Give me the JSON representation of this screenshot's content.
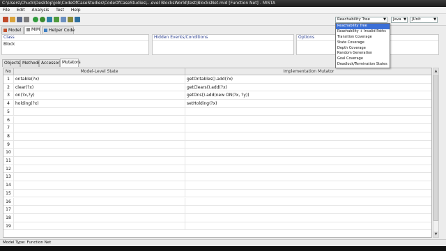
{
  "window": {
    "title": "C:\\Users\\Chuck\\Desktop\\job\\CodeOfCaseStudies\\CodeOfCaseStudies\\...evel BlocksWorld\\test\\BlocksNet.mid [Function Net] - MISTA"
  },
  "menu": [
    "File",
    "Edit",
    "Analysis",
    "Test",
    "Help"
  ],
  "toolbar": {
    "coverage_selected": "Reachability Tree",
    "language": "Java",
    "framework": "JUnit"
  },
  "coverage_options": [
    "Reachability Tree",
    "Reachability + Invalid Paths",
    "Transition Coverage",
    "State Coverage",
    "Depth Coverage",
    "Random Generation",
    "Goal Coverage",
    "Deadlock/Termination States"
  ],
  "top_tabs": [
    "Model",
    "MIM",
    "Helper Code"
  ],
  "panels": {
    "class_header": "Class",
    "class_value": "Block",
    "hidden_header": "Hidden Events/Conditions",
    "options_header": "Options"
  },
  "sub_tabs": [
    "Objects",
    "Methods",
    "Accessors",
    "Mutators"
  ],
  "grid": {
    "headers": [
      "No",
      "Model-Level State",
      "Implementation Mutator"
    ],
    "rows": [
      [
        "1",
        "ontable(?x)",
        "getOntables().add(?x)"
      ],
      [
        "2",
        "clear(?x)",
        "getClears().add(?x)"
      ],
      [
        "3",
        "on(?x,?y)",
        "getOns().add(new ON(?x, ?y))"
      ],
      [
        "4",
        "holding(?x)",
        "setHolding(?x)"
      ],
      [
        "5",
        "",
        ""
      ],
      [
        "6",
        "",
        ""
      ],
      [
        "7",
        "",
        ""
      ],
      [
        "8",
        "",
        ""
      ],
      [
        "9",
        "",
        ""
      ],
      [
        "10",
        "",
        ""
      ],
      [
        "11",
        "",
        ""
      ],
      [
        "12",
        "",
        ""
      ],
      [
        "13",
        "",
        ""
      ],
      [
        "14",
        "",
        ""
      ],
      [
        "15",
        "",
        ""
      ],
      [
        "16",
        "",
        ""
      ],
      [
        "17",
        "",
        ""
      ],
      [
        "18",
        "",
        ""
      ],
      [
        "19",
        "",
        ""
      ]
    ]
  },
  "status": "Model Type: Function Net",
  "colors": {
    "selection": "#3b6fd6",
    "header_text": "#2b3f8f"
  }
}
